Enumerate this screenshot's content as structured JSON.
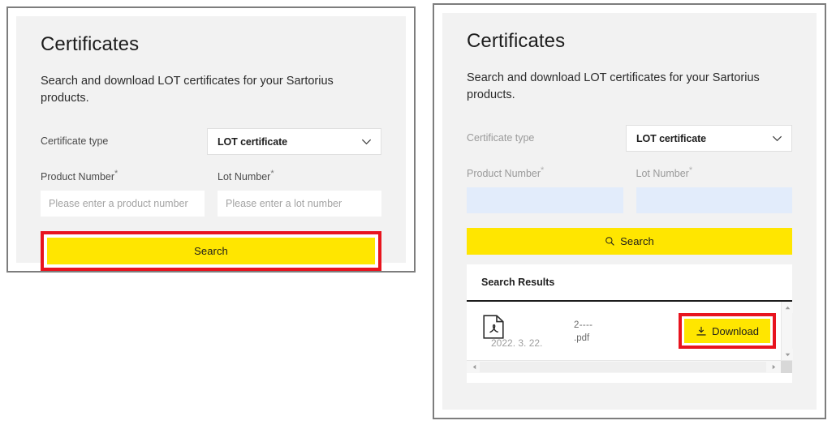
{
  "left_panel": {
    "title": "Certificates",
    "subtitle": "Search and download LOT certificates for your Sartorius products.",
    "certificate_type_label": "Certificate type",
    "certificate_type_value": "LOT certificate",
    "certificate_type_options": [
      "LOT certificate"
    ],
    "product_number_label": "Product Number",
    "product_number_required_mark": "*",
    "product_number_placeholder": "Please enter a product number",
    "product_number_value": "",
    "lot_number_label": "Lot Number",
    "lot_number_required_mark": "*",
    "lot_number_placeholder": "Please enter a lot number",
    "lot_number_value": "",
    "search_button_label": "Search"
  },
  "right_panel": {
    "title": "Certificates",
    "subtitle": "Search and download LOT certificates for your Sartorius products.",
    "certificate_type_label": "Certificate type",
    "certificate_type_value": "LOT certificate",
    "certificate_type_options": [
      "LOT certificate"
    ],
    "product_number_label": "Product Number",
    "product_number_required_mark": "*",
    "product_number_value": "",
    "lot_number_label": "Lot Number",
    "lot_number_required_mark": "*",
    "lot_number_value": "",
    "search_button_label": "Search",
    "search_icon": "magnifier-icon",
    "results": {
      "header": "Search Results",
      "rows": [
        {
          "file_icon": "pdf-file-icon",
          "file_name_line1": "2----",
          "file_name_line2": ".pdf",
          "date": "2022. 3. 22.",
          "download_label": "Download",
          "download_icon": "download-icon"
        }
      ]
    }
  },
  "colors": {
    "brand_yellow": "#ffe600",
    "highlight_red": "#e8141e",
    "panel_bg": "#f2f2f2",
    "input_filled_blue": "#e2ecfb",
    "panel_border": "#7d7d7d"
  }
}
